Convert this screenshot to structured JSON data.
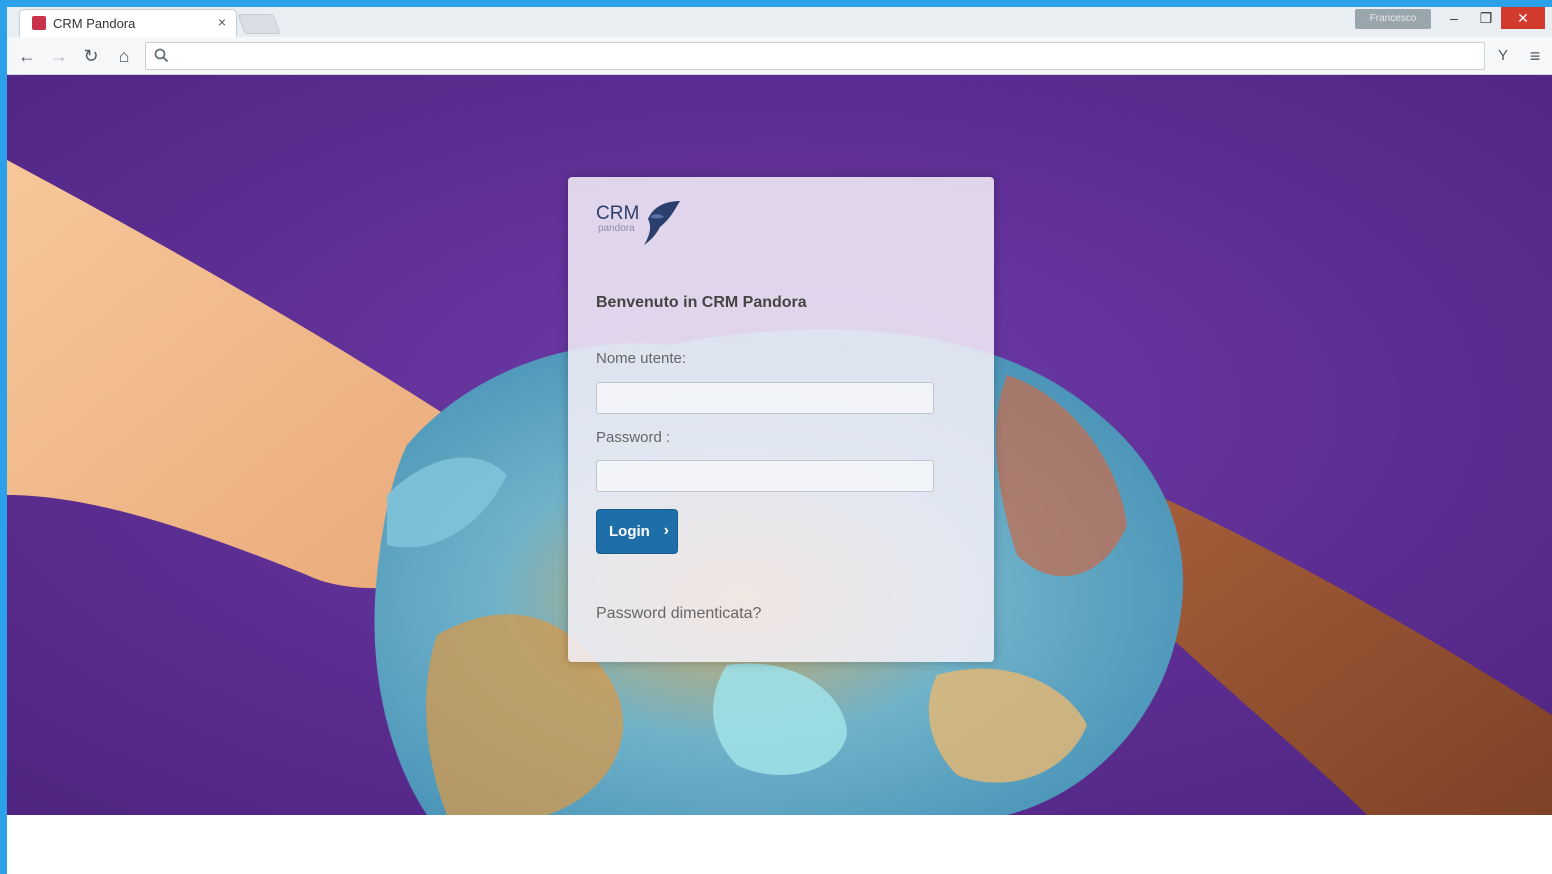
{
  "browser": {
    "tab": {
      "title": "CRM Pandora",
      "close_glyph": "×"
    },
    "profile_badge": "Francesco",
    "window_controls": {
      "minimize": "–",
      "maximize": "❐",
      "close": "✕"
    },
    "toolbar": {
      "back_icon": "←",
      "forward_icon": "→",
      "reload_icon": "↻",
      "home_icon": "⌂",
      "omnibox_value": "",
      "extension_icon": "Y",
      "menu_icon": "≡"
    }
  },
  "login": {
    "logo_text": "CRM",
    "logo_subtext": "pandora",
    "welcome": "Benvenuto in CRM Pandora",
    "username_label": "Nome utente:",
    "username_value": "",
    "password_label": "Password :",
    "password_value": "",
    "login_button": "Login",
    "login_chevron": "›",
    "forgot_password": "Password dimenticata?"
  },
  "colors": {
    "background_purple": "#5b2d92",
    "login_button": "#1e6fa9",
    "window_close": "#d33a2e",
    "desktop_blue": "#2aa1e8"
  }
}
